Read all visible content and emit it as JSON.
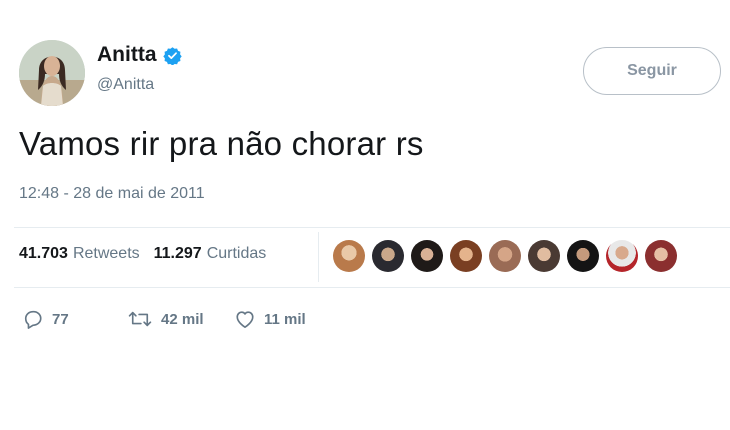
{
  "tweet": {
    "author": {
      "display_name": "Anitta",
      "handle": "@Anitta",
      "verified": true
    },
    "follow_label": "Seguir",
    "text": "Vamos rir pra não chorar rs",
    "timestamp": "12:48 - 28 de mai de 2011",
    "stats": {
      "retweets_count": "41.703",
      "retweets_label": "Retweets",
      "likes_count": "11.297",
      "likes_label": "Curtidas"
    },
    "actions": {
      "replies": "77",
      "retweets": "42 mil",
      "likes": "11 mil"
    }
  },
  "colors": {
    "verified_blue": "#1da1f2",
    "secondary_text": "#657786",
    "divider": "#e6ecf0"
  },
  "icons": {
    "verified": "verified-badge-icon",
    "reply": "reply-icon",
    "retweet": "retweet-icon",
    "like": "heart-icon"
  }
}
